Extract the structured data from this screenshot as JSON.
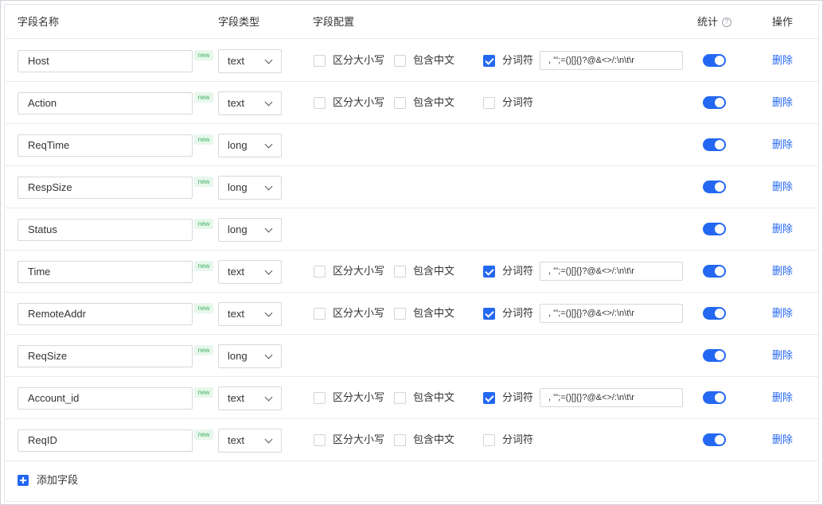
{
  "header": {
    "field_name": "字段名称",
    "field_type": "字段类型",
    "field_config": "字段配置",
    "stats": "统计",
    "stats_hint_icon": "question-circle-icon",
    "operation": "操作"
  },
  "config_labels": {
    "case_sensitive": "区分大小写",
    "include_chinese": "包含中文",
    "tokenizer": "分词符"
  },
  "new_badge": "new",
  "delete_label": "删除",
  "add_field_label": "添加字段",
  "accent_color": "#2468f2",
  "rows": [
    {
      "name": "Host",
      "type": "text",
      "config": true,
      "case_sensitive": false,
      "include_chinese": false,
      "tokenizer": true,
      "tokenizer_value": ", '\";=()[]{}?@&<>/:\\n\\t\\r",
      "stats_enabled": true
    },
    {
      "name": "Action",
      "type": "text",
      "config": true,
      "case_sensitive": false,
      "include_chinese": false,
      "tokenizer": false,
      "tokenizer_value": "",
      "stats_enabled": true
    },
    {
      "name": "ReqTime",
      "type": "long",
      "config": false,
      "stats_enabled": true
    },
    {
      "name": "RespSize",
      "type": "long",
      "config": false,
      "stats_enabled": true
    },
    {
      "name": "Status",
      "type": "long",
      "config": false,
      "stats_enabled": true
    },
    {
      "name": "Time",
      "type": "text",
      "config": true,
      "case_sensitive": false,
      "include_chinese": false,
      "tokenizer": true,
      "tokenizer_value": ", '\";=()[]{}?@&<>/:\\n\\t\\r",
      "stats_enabled": true
    },
    {
      "name": "RemoteAddr",
      "type": "text",
      "config": true,
      "case_sensitive": false,
      "include_chinese": false,
      "tokenizer": true,
      "tokenizer_value": ", '\";=()[]{}?@&<>/:\\n\\t\\r",
      "stats_enabled": true
    },
    {
      "name": "ReqSize",
      "type": "long",
      "config": false,
      "stats_enabled": true
    },
    {
      "name": "Account_id",
      "type": "text",
      "config": true,
      "case_sensitive": false,
      "include_chinese": false,
      "tokenizer": true,
      "tokenizer_value": ", '\";=()[]{}?@&<>/:\\n\\t\\r",
      "stats_enabled": true
    },
    {
      "name": "ReqID",
      "type": "text",
      "config": true,
      "case_sensitive": false,
      "include_chinese": false,
      "tokenizer": false,
      "tokenizer_value": "",
      "stats_enabled": true
    }
  ]
}
